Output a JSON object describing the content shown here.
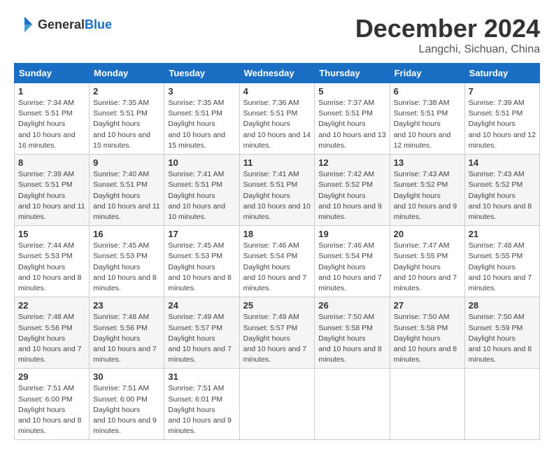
{
  "header": {
    "logo_general": "General",
    "logo_blue": "Blue",
    "month_title": "December 2024",
    "location": "Langchi, Sichuan, China"
  },
  "weekdays": [
    "Sunday",
    "Monday",
    "Tuesday",
    "Wednesday",
    "Thursday",
    "Friday",
    "Saturday"
  ],
  "weeks": [
    [
      {
        "day": "1",
        "sunrise": "7:34 AM",
        "sunset": "5:51 PM",
        "daylight": "10 hours and 16 minutes."
      },
      {
        "day": "2",
        "sunrise": "7:35 AM",
        "sunset": "5:51 PM",
        "daylight": "10 hours and 15 minutes."
      },
      {
        "day": "3",
        "sunrise": "7:35 AM",
        "sunset": "5:51 PM",
        "daylight": "10 hours and 15 minutes."
      },
      {
        "day": "4",
        "sunrise": "7:36 AM",
        "sunset": "5:51 PM",
        "daylight": "10 hours and 14 minutes."
      },
      {
        "day": "5",
        "sunrise": "7:37 AM",
        "sunset": "5:51 PM",
        "daylight": "10 hours and 13 minutes."
      },
      {
        "day": "6",
        "sunrise": "7:38 AM",
        "sunset": "5:51 PM",
        "daylight": "10 hours and 12 minutes."
      },
      {
        "day": "7",
        "sunrise": "7:39 AM",
        "sunset": "5:51 PM",
        "daylight": "10 hours and 12 minutes."
      }
    ],
    [
      {
        "day": "8",
        "sunrise": "7:39 AM",
        "sunset": "5:51 PM",
        "daylight": "10 hours and 11 minutes."
      },
      {
        "day": "9",
        "sunrise": "7:40 AM",
        "sunset": "5:51 PM",
        "daylight": "10 hours and 11 minutes."
      },
      {
        "day": "10",
        "sunrise": "7:41 AM",
        "sunset": "5:51 PM",
        "daylight": "10 hours and 10 minutes."
      },
      {
        "day": "11",
        "sunrise": "7:41 AM",
        "sunset": "5:51 PM",
        "daylight": "10 hours and 10 minutes."
      },
      {
        "day": "12",
        "sunrise": "7:42 AM",
        "sunset": "5:52 PM",
        "daylight": "10 hours and 9 minutes."
      },
      {
        "day": "13",
        "sunrise": "7:43 AM",
        "sunset": "5:52 PM",
        "daylight": "10 hours and 9 minutes."
      },
      {
        "day": "14",
        "sunrise": "7:43 AM",
        "sunset": "5:52 PM",
        "daylight": "10 hours and 8 minutes."
      }
    ],
    [
      {
        "day": "15",
        "sunrise": "7:44 AM",
        "sunset": "5:53 PM",
        "daylight": "10 hours and 8 minutes."
      },
      {
        "day": "16",
        "sunrise": "7:45 AM",
        "sunset": "5:53 PM",
        "daylight": "10 hours and 8 minutes."
      },
      {
        "day": "17",
        "sunrise": "7:45 AM",
        "sunset": "5:53 PM",
        "daylight": "10 hours and 8 minutes."
      },
      {
        "day": "18",
        "sunrise": "7:46 AM",
        "sunset": "5:54 PM",
        "daylight": "10 hours and 7 minutes."
      },
      {
        "day": "19",
        "sunrise": "7:46 AM",
        "sunset": "5:54 PM",
        "daylight": "10 hours and 7 minutes."
      },
      {
        "day": "20",
        "sunrise": "7:47 AM",
        "sunset": "5:55 PM",
        "daylight": "10 hours and 7 minutes."
      },
      {
        "day": "21",
        "sunrise": "7:48 AM",
        "sunset": "5:55 PM",
        "daylight": "10 hours and 7 minutes."
      }
    ],
    [
      {
        "day": "22",
        "sunrise": "7:48 AM",
        "sunset": "5:56 PM",
        "daylight": "10 hours and 7 minutes."
      },
      {
        "day": "23",
        "sunrise": "7:48 AM",
        "sunset": "5:56 PM",
        "daylight": "10 hours and 7 minutes."
      },
      {
        "day": "24",
        "sunrise": "7:49 AM",
        "sunset": "5:57 PM",
        "daylight": "10 hours and 7 minutes."
      },
      {
        "day": "25",
        "sunrise": "7:49 AM",
        "sunset": "5:57 PM",
        "daylight": "10 hours and 7 minutes."
      },
      {
        "day": "26",
        "sunrise": "7:50 AM",
        "sunset": "5:58 PM",
        "daylight": "10 hours and 8 minutes."
      },
      {
        "day": "27",
        "sunrise": "7:50 AM",
        "sunset": "5:58 PM",
        "daylight": "10 hours and 8 minutes."
      },
      {
        "day": "28",
        "sunrise": "7:50 AM",
        "sunset": "5:59 PM",
        "daylight": "10 hours and 8 minutes."
      }
    ],
    [
      {
        "day": "29",
        "sunrise": "7:51 AM",
        "sunset": "6:00 PM",
        "daylight": "10 hours and 8 minutes."
      },
      {
        "day": "30",
        "sunrise": "7:51 AM",
        "sunset": "6:00 PM",
        "daylight": "10 hours and 9 minutes."
      },
      {
        "day": "31",
        "sunrise": "7:51 AM",
        "sunset": "6:01 PM",
        "daylight": "10 hours and 9 minutes."
      },
      null,
      null,
      null,
      null
    ]
  ]
}
